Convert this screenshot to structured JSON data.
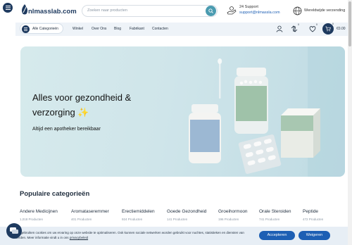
{
  "header": {
    "logo_text": "nlmasslab.com",
    "search_placeholder": "Zoeken naar producten",
    "support_label": "24 Support",
    "support_email": "support@nlmassla.com",
    "shipping_label": "Wereldwijde verzending"
  },
  "nav": {
    "categories_label": "Alle Categorieën",
    "links": [
      "Winkel",
      "Over Ons",
      "Blog",
      "Fabrikant",
      "Contacten"
    ],
    "compare_badge": "0",
    "wishlist_badge": "0",
    "cart_badge": "0",
    "cart_total": "€0.00"
  },
  "hero": {
    "title": "Alles voor gezondheid & verzorging ✨",
    "subtitle": "Altijd een apotheker bereikbaar"
  },
  "categories": {
    "title": "Populaire categorieën",
    "items": [
      {
        "name": "Andere Medicijnen",
        "count": "1,018 Producten"
      },
      {
        "name": "Aromataseremmer",
        "count": "401 Producten"
      },
      {
        "name": "Erectiemiddelen",
        "count": "924 Producten"
      },
      {
        "name": "Goede Gezondheid",
        "count": "141 Producten"
      },
      {
        "name": "Groeihormoon",
        "count": "196 Producten"
      },
      {
        "name": "Orale Steroiden",
        "count": "741 Producten"
      },
      {
        "name": "Peptide",
        "count": "472 Producten"
      }
    ]
  },
  "cookie": {
    "text": "Wij gebruiken cookies om uw ervaring op onze website te optimaliseren. Ook kunnen sociale netwerken worden gebruikt voor nuchtes, statistieken en diensten van derden. Meer informatie vindt u in ons",
    "link": "privacybeleid",
    "accept_label": "Accepteren",
    "deny_label": "Weigeren"
  },
  "colors": {
    "brand": "#1e3a5f",
    "accent": "#1d5fb4",
    "search_button": "#4a9bb0"
  }
}
